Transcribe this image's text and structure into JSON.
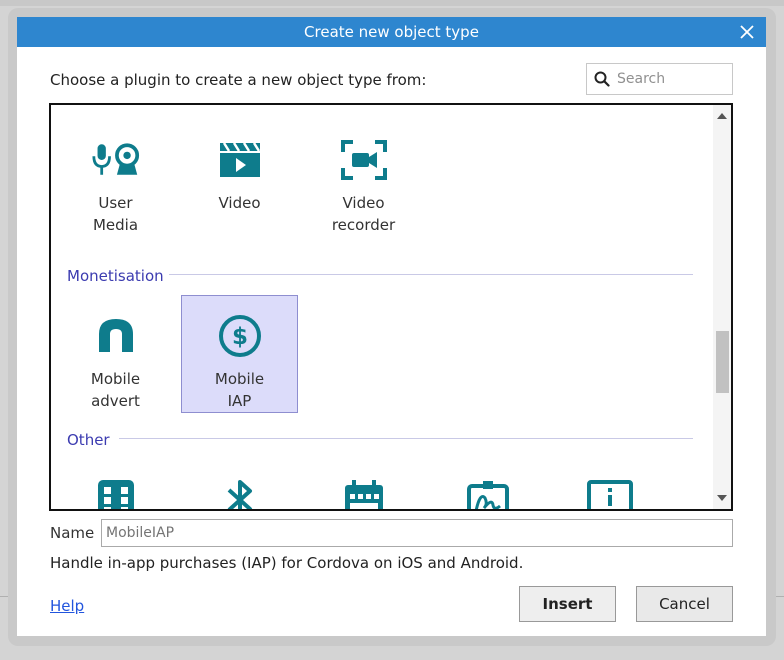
{
  "dialog": {
    "title": "Create new object type",
    "prompt": "Choose a plugin to create a new object type from:",
    "search_placeholder": "Search"
  },
  "colors": {
    "titlebar": "#2e86cf",
    "icon": "#0e7c8c",
    "category_text": "#3b3bb0",
    "selection_bg": "#dcdcfa"
  },
  "plugins": {
    "media": [
      {
        "label": "User\nMedia",
        "icon": "user-media-icon"
      },
      {
        "label": "Video",
        "icon": "video-icon"
      },
      {
        "label": "Video\nrecorder",
        "icon": "video-recorder-icon"
      }
    ],
    "monetisation_label": "Monetisation",
    "monetisation": [
      {
        "label": "Mobile\nadvert",
        "icon": "mobile-advert-icon"
      },
      {
        "label": "Mobile\nIAP",
        "icon": "dollar-icon",
        "selected": true
      }
    ],
    "other_label": "Other",
    "other": [
      {
        "icon": "dice-icon"
      },
      {
        "icon": "bluetooth-icon"
      },
      {
        "icon": "calendar-icon"
      },
      {
        "icon": "signature-icon"
      },
      {
        "icon": "info-display-icon"
      }
    ]
  },
  "form": {
    "name_label": "Name",
    "name_value": "MobileIAP",
    "description": "Handle in-app purchases (IAP) for Cordova on iOS and Android."
  },
  "footer": {
    "help_label": "Help",
    "insert_label": "Insert",
    "cancel_label": "Cancel"
  }
}
